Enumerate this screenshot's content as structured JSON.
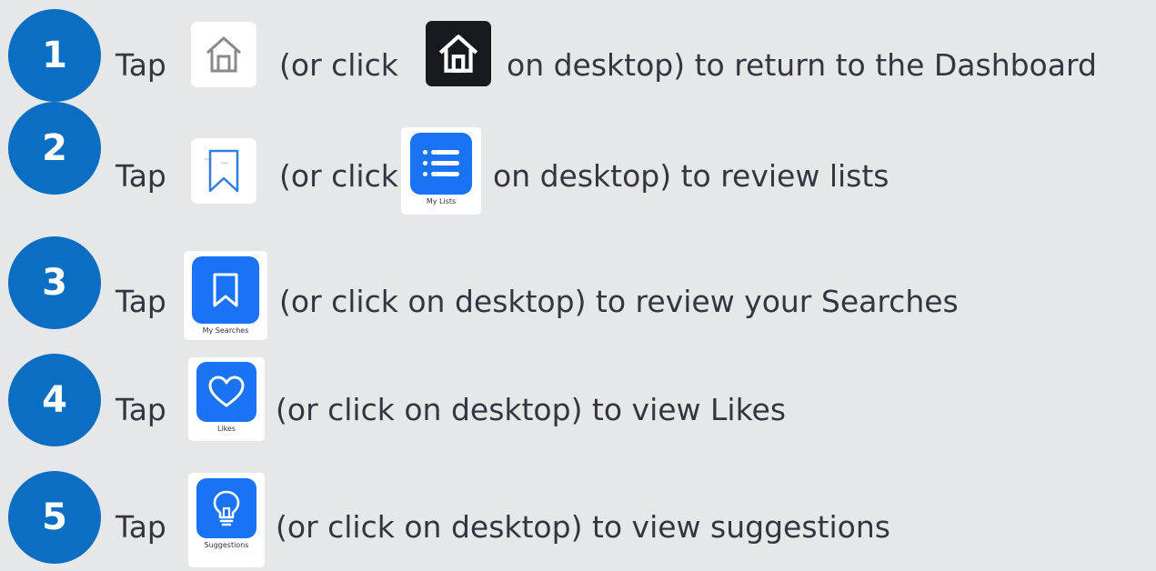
{
  "steps": [
    {
      "number": "1",
      "tap": "Tap",
      "rest": "(or click",
      "rest2": "on desktop) to return to the Dashboard"
    },
    {
      "number": "2",
      "tap": "Tap",
      "rest": "(or click",
      "rest2": "on desktop) to review lists"
    },
    {
      "number": "3",
      "tap": "Tap",
      "rest": "(or click on desktop) to review your Searches"
    },
    {
      "number": "4",
      "tap": "Tap",
      "rest": "(or click on desktop) to view Likes"
    },
    {
      "number": "5",
      "tap": "Tap",
      "rest": "(or click on desktop) to view suggestions"
    }
  ],
  "icon_labels": {
    "my_lists": "My Lists",
    "my_searches": "My Searches",
    "likes": "Likes",
    "suggestions": "Suggestions"
  },
  "colors": {
    "background": "#e6e7e8",
    "badge": "#0a6ec2",
    "app_blue": "#1a73f5",
    "text": "#333640"
  },
  "icons": [
    "home-outline-icon",
    "home-dark-icon",
    "bookmark-outline-icon",
    "list-app-icon",
    "bookmark-app-icon",
    "heart-app-icon",
    "lightbulb-app-icon"
  ]
}
